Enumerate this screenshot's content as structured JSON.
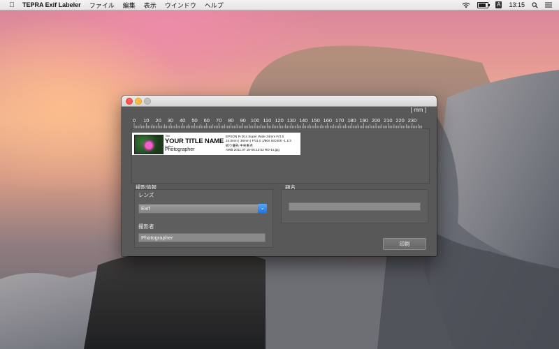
{
  "menubar": {
    "apple_icon": "apple-logo-icon",
    "app_name": "TEPRA Exif Labeler",
    "items": [
      "ファイル",
      "編集",
      "表示",
      "ウインドウ",
      "ヘルプ"
    ],
    "status": {
      "wifi_icon": "wifi-icon",
      "battery_icon": "battery-icon",
      "input_source": "A",
      "clock": "13:15",
      "search_icon": "spotlight-search-icon",
      "list_icon": "notification-center-icon"
    }
  },
  "window": {
    "unit_label": "[ mm ]",
    "ruler": {
      "ticks": [
        "0",
        "10",
        "20",
        "30",
        "40",
        "50",
        "60",
        "70",
        "80",
        "90",
        "100",
        "110",
        "120",
        "130",
        "140",
        "150",
        "160",
        "170",
        "180",
        "190",
        "200",
        "210",
        "220",
        "230"
      ]
    },
    "label_preview": {
      "title_caption": "Title",
      "title": "YOUR TITLE NAME",
      "author_caption": "Author",
      "author": "Photographer",
      "exif_lines": [
        "EPSON R-D1s  Super Wide 24mm F/3.5",
        "24.0mm | 36mm | F/11.0 1/80s ISO200 -1 1/3",
        "絞り優先    中央重点",
        "AWB 2011.07.16-06:12:52 RD-1s.jpg"
      ]
    },
    "shooting_info": {
      "section_title": "撮影情報",
      "lens_label": "レンズ",
      "lens_value": "Exif",
      "photographer_label": "撮影者",
      "photographer_value": "Photographer"
    },
    "title_section": {
      "section_title": "題名",
      "title_value": ""
    },
    "print_button": "印刷"
  }
}
